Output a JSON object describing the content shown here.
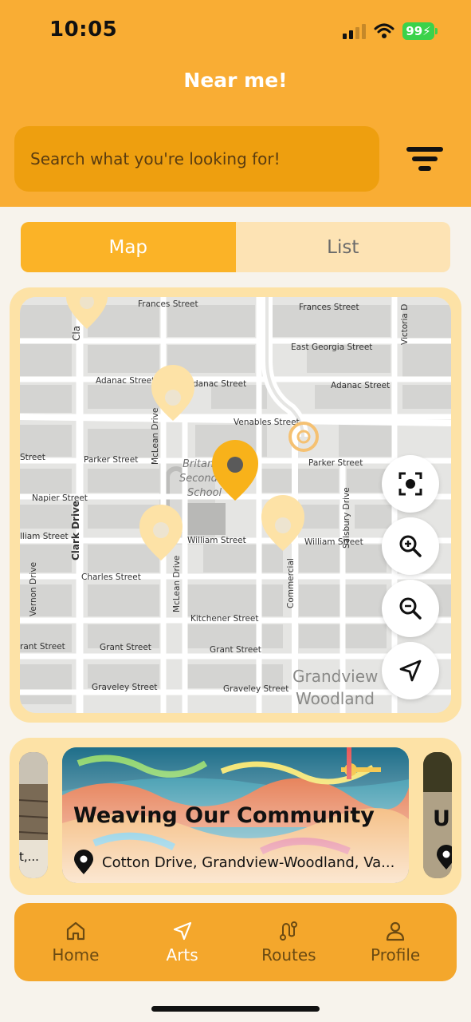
{
  "status_bar": {
    "time": "10:05",
    "battery": "99"
  },
  "header": {
    "title": "Near me!"
  },
  "search": {
    "placeholder": "Search what you're looking for!"
  },
  "view_toggle": {
    "map_label": "Map",
    "list_label": "List",
    "active": "Map"
  },
  "map": {
    "street_labels": [
      "Frances Street",
      "Frances Street",
      "East Georgia Street",
      "Adanac Street",
      "Adanac Street",
      "Adanac Street",
      "Venables Street",
      "Parker Street",
      "Parker Street",
      "Street",
      "Napier Street",
      "William Street",
      "William Street",
      "William Street",
      "Charles Street",
      "Kitchener Street",
      "Grant Street",
      "Grant Street",
      "Graveley Street",
      "Graveley Street",
      "Clark Drive",
      "McLean Drive",
      "McLean Drive",
      "Commercial",
      "Salsbury Drive",
      "Vernon Drive",
      "Victoria D",
      "Britan",
      "Second",
      "School",
      "Grandview",
      "Woodland"
    ],
    "controls": [
      "focus-location",
      "zoom-in",
      "zoom-out",
      "navigate"
    ]
  },
  "carousel": {
    "left_peek_text": "t,...",
    "featured": {
      "title": "Weaving Our Community",
      "location": "Cotton Drive, Grandview-Woodland, Va..."
    },
    "right_peek_text": "Ur"
  },
  "bottom_nav": [
    {
      "label": "Home",
      "icon": "home-icon",
      "active": false
    },
    {
      "label": "Arts",
      "icon": "navigation-arrow-icon",
      "active": true
    },
    {
      "label": "Routes",
      "icon": "route-icon",
      "active": false
    },
    {
      "label": "Profile",
      "icon": "person-icon",
      "active": false
    }
  ],
  "colors": {
    "primary": "#f9ad34",
    "search_bg": "#ee9f0f",
    "tab_active": "#fbb327",
    "card_bg": "#fde2a6"
  }
}
